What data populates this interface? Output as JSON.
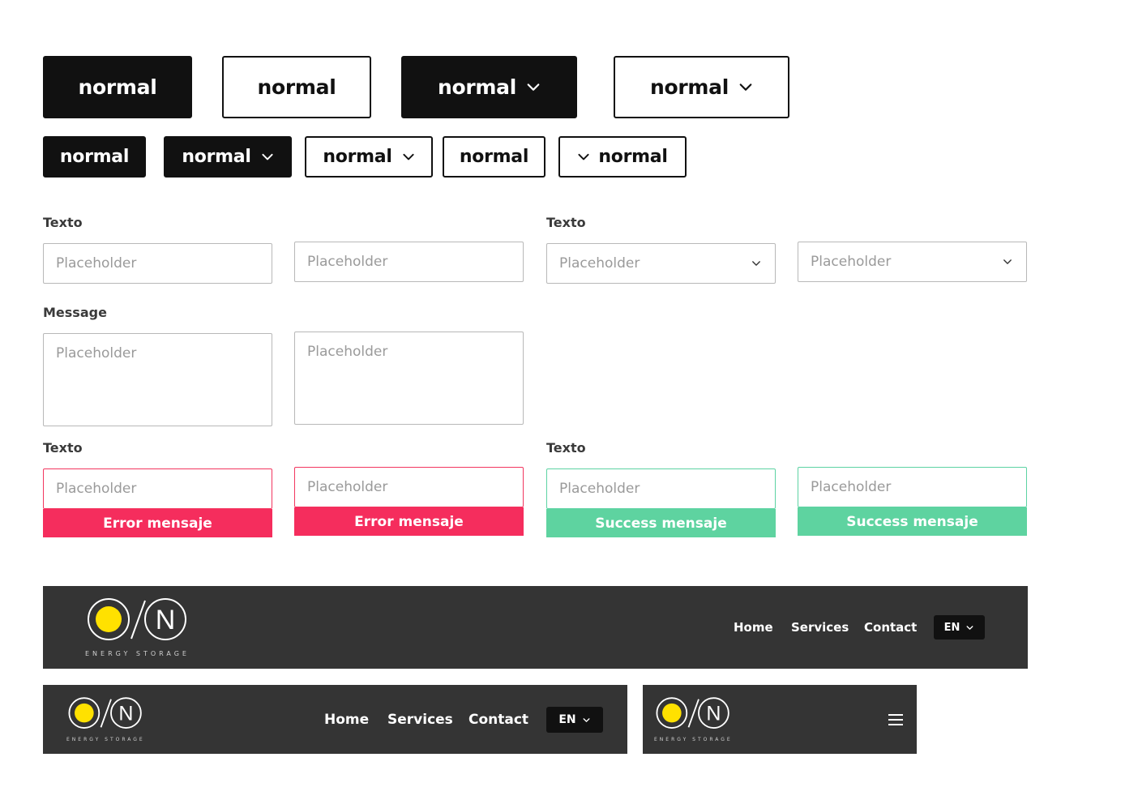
{
  "buttons": {
    "label": "normal"
  },
  "forms": {
    "label_texto": "Texto",
    "label_message": "Message",
    "placeholder": "Placeholder",
    "error_message": "Error mensaje",
    "success_message": "Success mensaje"
  },
  "nav": {
    "home": "Home",
    "services": "Services",
    "contact": "Contact",
    "lang": "EN",
    "logo_sub": "ENERGY STORAGE"
  },
  "colors": {
    "dark": "#111111",
    "nav_bg": "#343434",
    "error": "#f52d5d",
    "success": "#5ed3a0",
    "logo_yellow": "#ffe100"
  },
  "icons": {
    "chevron": "chevron-down-icon",
    "menu": "hamburger-menu-icon",
    "logo": "logo-icon"
  }
}
